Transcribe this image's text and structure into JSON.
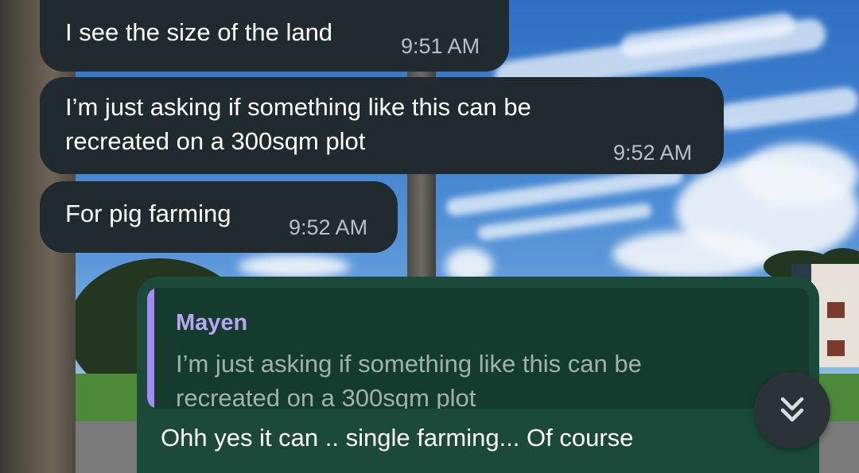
{
  "messages": [
    {
      "direction": "incoming",
      "text": "I see the size of the land",
      "time": "9:51 AM"
    },
    {
      "direction": "incoming",
      "text": "I’m just asking if something like this can be\nrecreated on a 300sqm plot",
      "time": "9:52 AM"
    },
    {
      "direction": "incoming",
      "text": "For pig farming",
      "time": "9:52 AM"
    }
  ],
  "reply": {
    "direction": "outgoing",
    "quoted_author": "Mayen",
    "quoted_text": "I’m just asking if something like this can be\nrecreated on a 300sqm plot",
    "text": "Ohh yes it can .. single farming... Of course"
  },
  "scroll_button": {
    "icon": "double-chevron-down-icon"
  },
  "colors": {
    "incoming_bubble": "#212a2f",
    "outgoing_bubble": "#1c4a3a",
    "quote_accent": "#a58cf0",
    "quote_author": "#b8a6f5"
  }
}
